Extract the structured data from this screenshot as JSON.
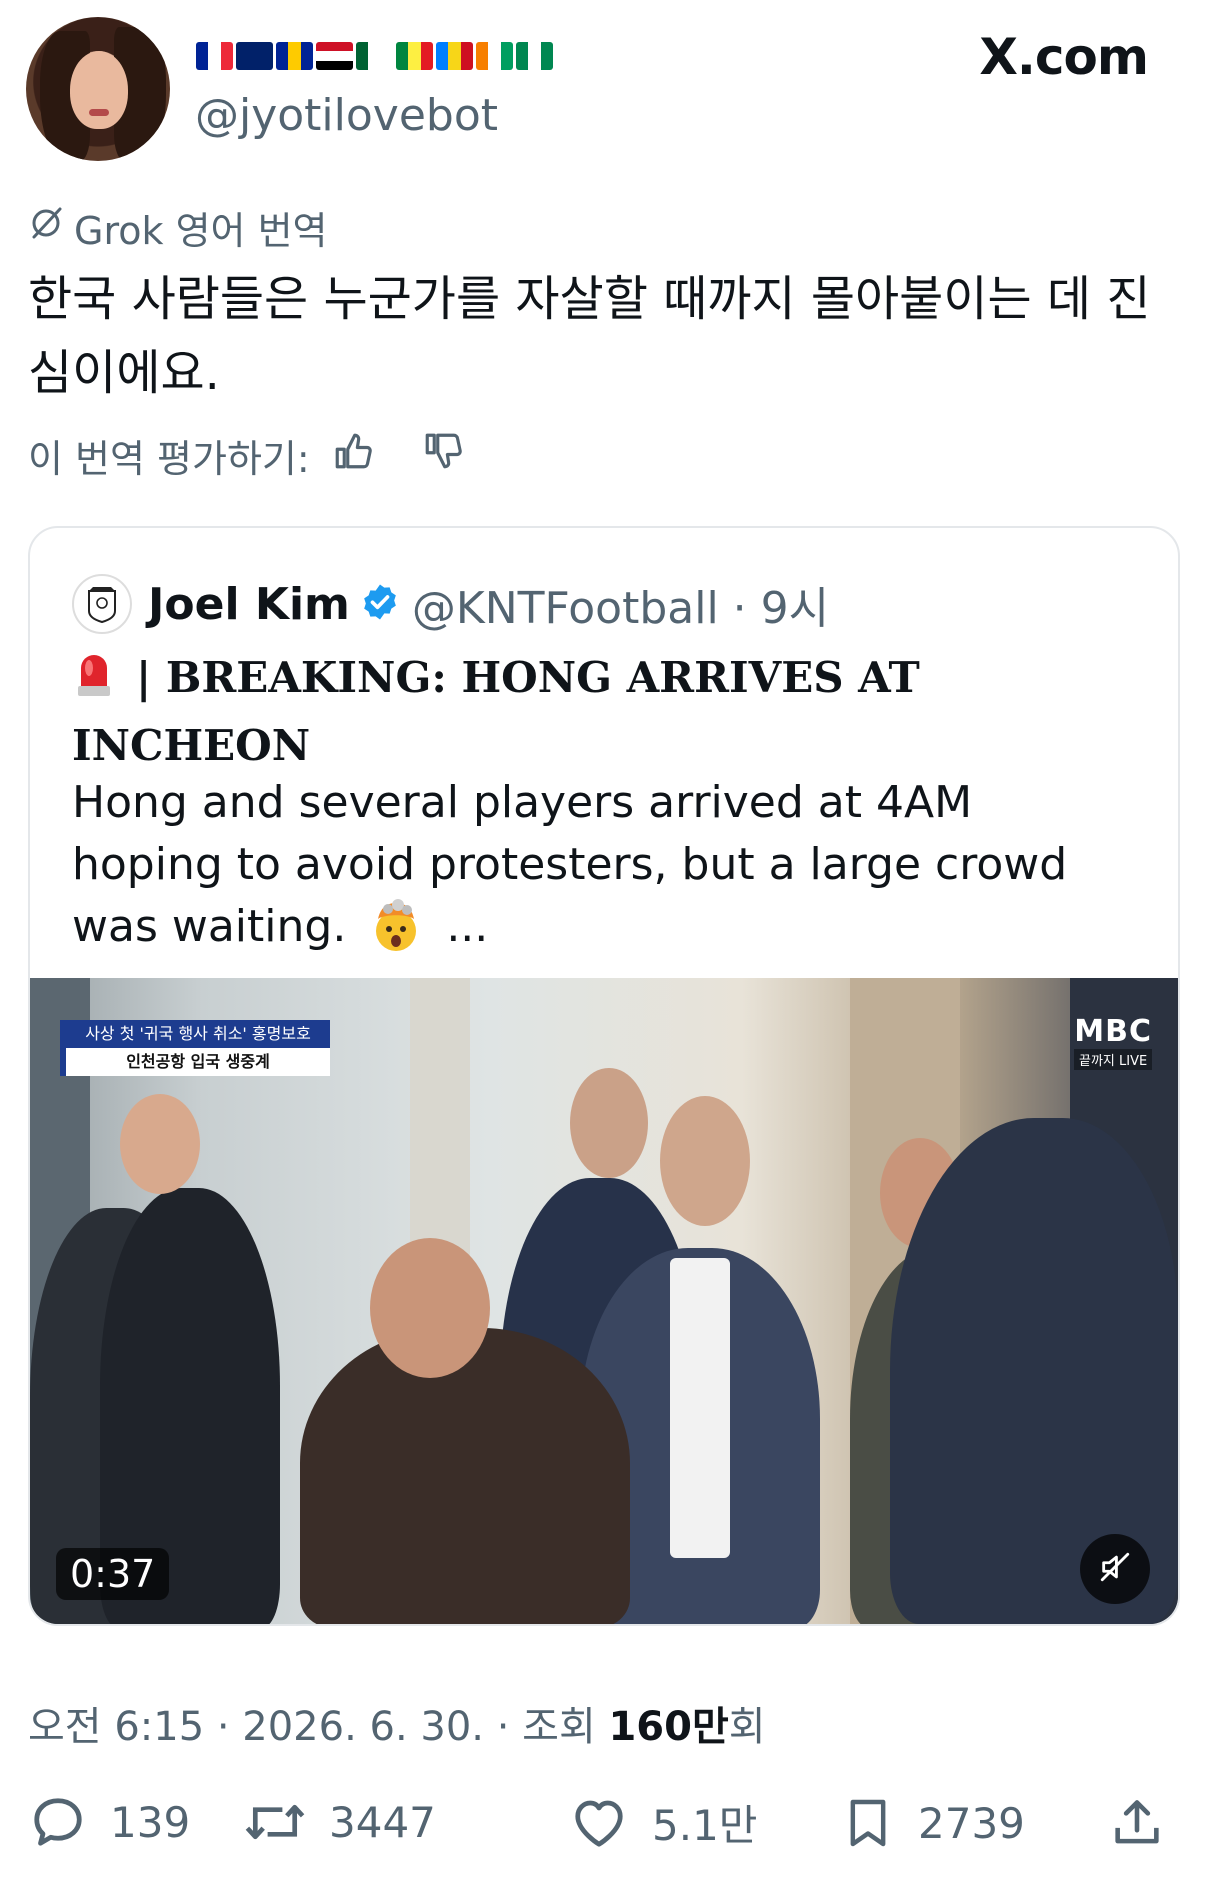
{
  "header": {
    "handle": "@jyotilovebot",
    "site": "X.com",
    "flags": [
      {
        "name": "france-flag",
        "dir": "v",
        "colors": [
          "#002395",
          "#ffffff",
          "#ed2939"
        ]
      },
      {
        "name": "australia-flag",
        "dir": "v",
        "colors": [
          "#012169",
          "#012169",
          "#012169"
        ]
      },
      {
        "name": "bosnia-flag",
        "dir": "v",
        "colors": [
          "#002395",
          "#fecb00",
          "#002395"
        ]
      },
      {
        "name": "egypt-flag",
        "dir": "h",
        "colors": [
          "#ce1126",
          "#ffffff",
          "#000000"
        ]
      },
      {
        "name": "algeria-flag",
        "dir": "v",
        "colors": [
          "#006233",
          "#ffffff",
          "#ffffff"
        ]
      },
      {
        "name": "senegal-flag",
        "dir": "v",
        "colors": [
          "#00853f",
          "#fdef42",
          "#e31b23"
        ]
      },
      {
        "name": "dr-congo-flag",
        "dir": "v",
        "colors": [
          "#007fff",
          "#f7d618",
          "#ce1021"
        ]
      },
      {
        "name": "ivory-coast-flag",
        "dir": "v",
        "colors": [
          "#f77f00",
          "#ffffff",
          "#009e60"
        ]
      },
      {
        "name": "nigeria-flag",
        "dir": "v",
        "colors": [
          "#008751",
          "#ffffff",
          "#008751"
        ]
      }
    ]
  },
  "translation": {
    "label": "Grok 영어 번역",
    "text": "한국 사람들은 누군가를 자살할 때까지 몰아붙이는 데 진심이에요.",
    "rate_label": "이 번역 평가하기:"
  },
  "quote": {
    "name": "Joel Kim",
    "handle_time": "@KNTFootball · 9시",
    "title": "| BREAKING: HONG ARRIVES AT INCHEON",
    "body": "Hong and several players arrived at 4AM hoping to avoid protesters, but a large crowd was waiting.",
    "ellipsis": "...",
    "video": {
      "banner_top": "사상 첫 '귀국 행사 취소' 홍명보호",
      "banner_bottom": "인천공항 입국 생중계",
      "channel": "MBC",
      "channel_sub": "끝까지 LIVE",
      "duration": "0:37"
    }
  },
  "meta": {
    "time": "오전 6:15 · 2026. 6. 30. · 조회 ",
    "views": "160만",
    "views_suffix": "회"
  },
  "actions": {
    "replies": "139",
    "reposts": "3447",
    "likes": "5.1만",
    "bookmarks": "2739"
  },
  "colors": {
    "text": "#0f1419",
    "muted": "#536471",
    "verified": "#1d9bf0",
    "border": "#e4e7ea"
  }
}
